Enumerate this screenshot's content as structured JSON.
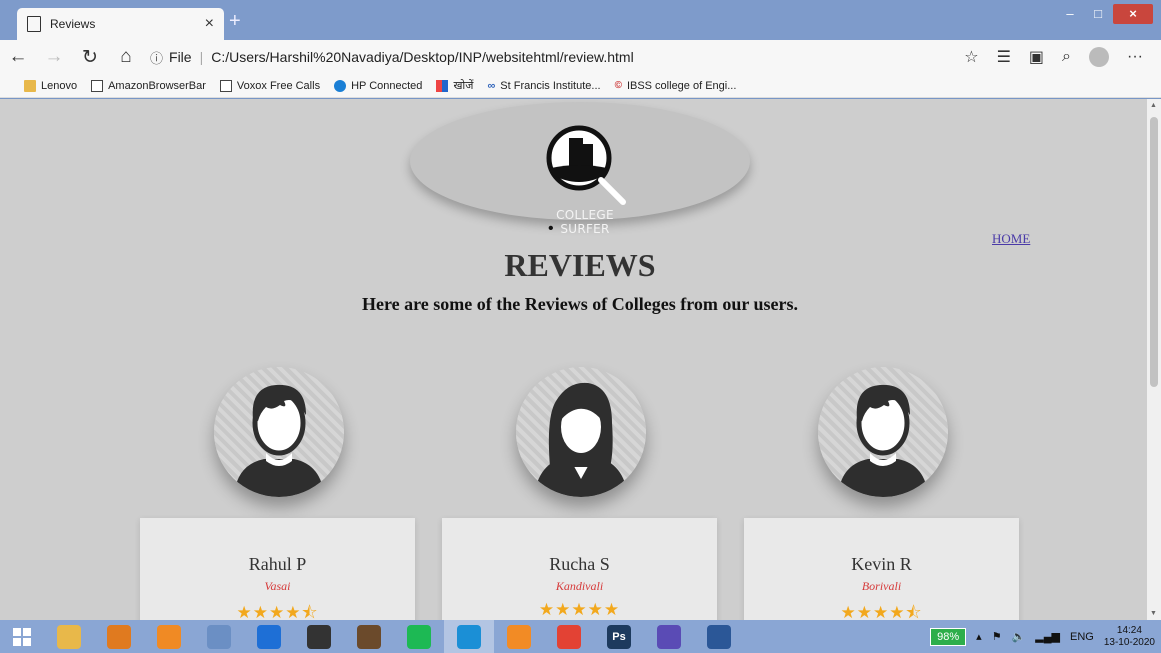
{
  "browser": {
    "tab_title": "Reviews",
    "tab_close": "×",
    "new_tab": "+",
    "window_controls": {
      "minimize": "–",
      "maximize": "□",
      "close": "×"
    },
    "nav": {
      "back": "←",
      "forward": "→",
      "refresh": "↻",
      "home": "⌂"
    },
    "url_prefix": "File",
    "url": "C:/Users/Harshil%20Navadiya/Desktop/INP/websitehtml/review.html",
    "tool_icons": {
      "favorite": "☆",
      "favorites": "☰",
      "collections": "▣",
      "share": "⌕",
      "more": "···"
    },
    "bookmarks": [
      {
        "label": "Lenovo",
        "icon": "folder-icon"
      },
      {
        "label": "AmazonBrowserBar",
        "icon": "page-icon"
      },
      {
        "label": "Voxox Free Calls",
        "icon": "page-icon"
      },
      {
        "label": "HP Connected",
        "icon": "hp-icon"
      },
      {
        "label": "खोजें",
        "icon": "grid-icon"
      },
      {
        "label": "St Francis Institute...",
        "icon": "infinity-icon"
      },
      {
        "label": "IBSS college of Engi...",
        "icon": "ibss-icon"
      }
    ]
  },
  "page": {
    "logo_text": "COLLEGE SURFER",
    "bullet": "•",
    "home_link": "HOME",
    "title": "REVIEWS",
    "subtitle": "Here are some of the Reviews of Colleges from our users.",
    "reviews": [
      {
        "name": "Rahul P",
        "location": "Vasai",
        "rating": 4.5,
        "stars": "★★★★⯪",
        "gender": "male"
      },
      {
        "name": "Rucha S",
        "location": "Kandivali",
        "rating": 5,
        "stars": "★★★★★",
        "gender": "female"
      },
      {
        "name": "Kevin R",
        "location": "Borivali",
        "rating": 4.5,
        "stars": "★★★★⯪",
        "gender": "male"
      }
    ]
  },
  "taskbar": {
    "apps": [
      {
        "name": "file-explorer",
        "color": "#e8b84a"
      },
      {
        "name": "media-player",
        "color": "#e07a1f"
      },
      {
        "name": "vlc",
        "color": "#f08a24"
      },
      {
        "name": "photos",
        "color": "#6b8fc4"
      },
      {
        "name": "teamviewer",
        "color": "#1e6fd6"
      },
      {
        "name": "cs-game",
        "color": "#333333"
      },
      {
        "name": "game-character",
        "color": "#6b4a2b"
      },
      {
        "name": "spotify",
        "color": "#1db954"
      },
      {
        "name": "edge",
        "color": "#1b8fd6"
      },
      {
        "name": "sublime-text",
        "color": "#f28b25"
      },
      {
        "name": "chrome",
        "color": "#e34234"
      },
      {
        "name": "photoshop",
        "color": "#1d3a5e",
        "label": "Ps"
      },
      {
        "name": "settings",
        "color": "#5a4bb5"
      },
      {
        "name": "word",
        "color": "#2b5797"
      }
    ],
    "battery": "98%",
    "language": "ENG",
    "time": "14:24",
    "date": "13-10-2020"
  }
}
